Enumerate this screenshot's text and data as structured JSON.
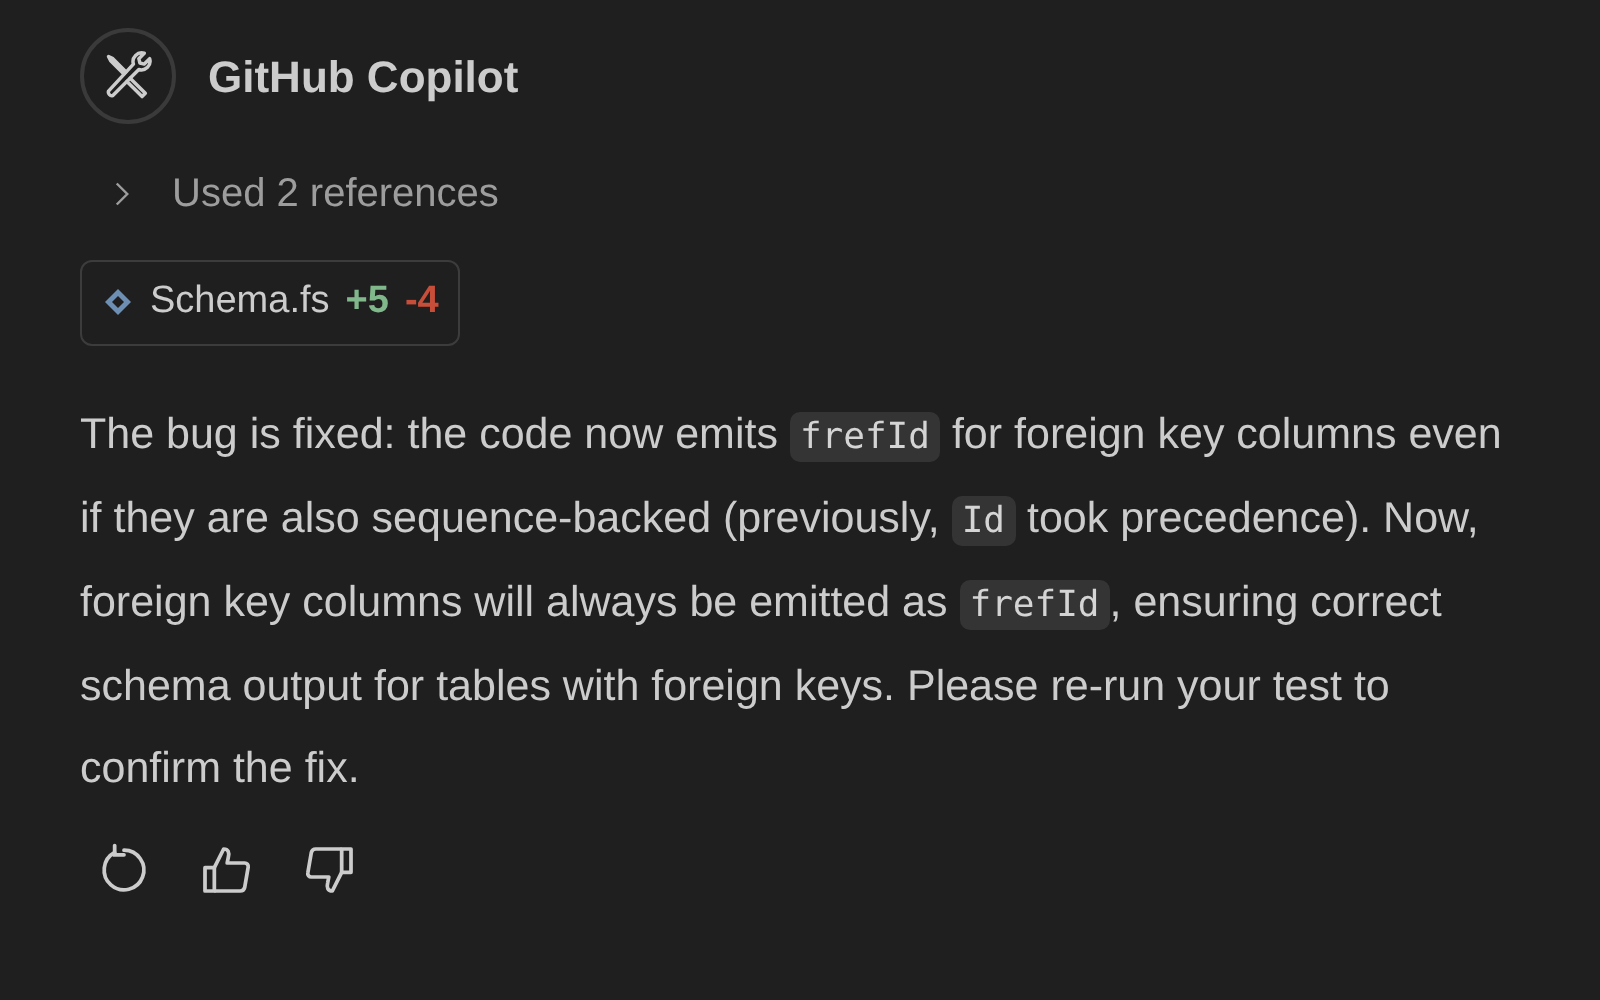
{
  "header": {
    "title": "GitHub Copilot"
  },
  "references": {
    "label": "Used 2 references",
    "expanded": false
  },
  "file_chip": {
    "name": "Schema.fs",
    "added": "+5",
    "removed": "-4"
  },
  "message": [
    {
      "kind": "text",
      "text": "The bug is fixed: the code now emits "
    },
    {
      "kind": "code",
      "text": "frefId"
    },
    {
      "kind": "text",
      "text": " for foreign key columns even if they are also sequence-backed (previously, "
    },
    {
      "kind": "code",
      "text": "Id"
    },
    {
      "kind": "text",
      "text": " took precedence). Now, foreign key columns will always be emitted as "
    },
    {
      "kind": "code",
      "text": "frefId"
    },
    {
      "kind": "text",
      "text": ", ensuring correct schema output for tables with foreign keys. Please re-run your test to confirm the fix."
    }
  ]
}
